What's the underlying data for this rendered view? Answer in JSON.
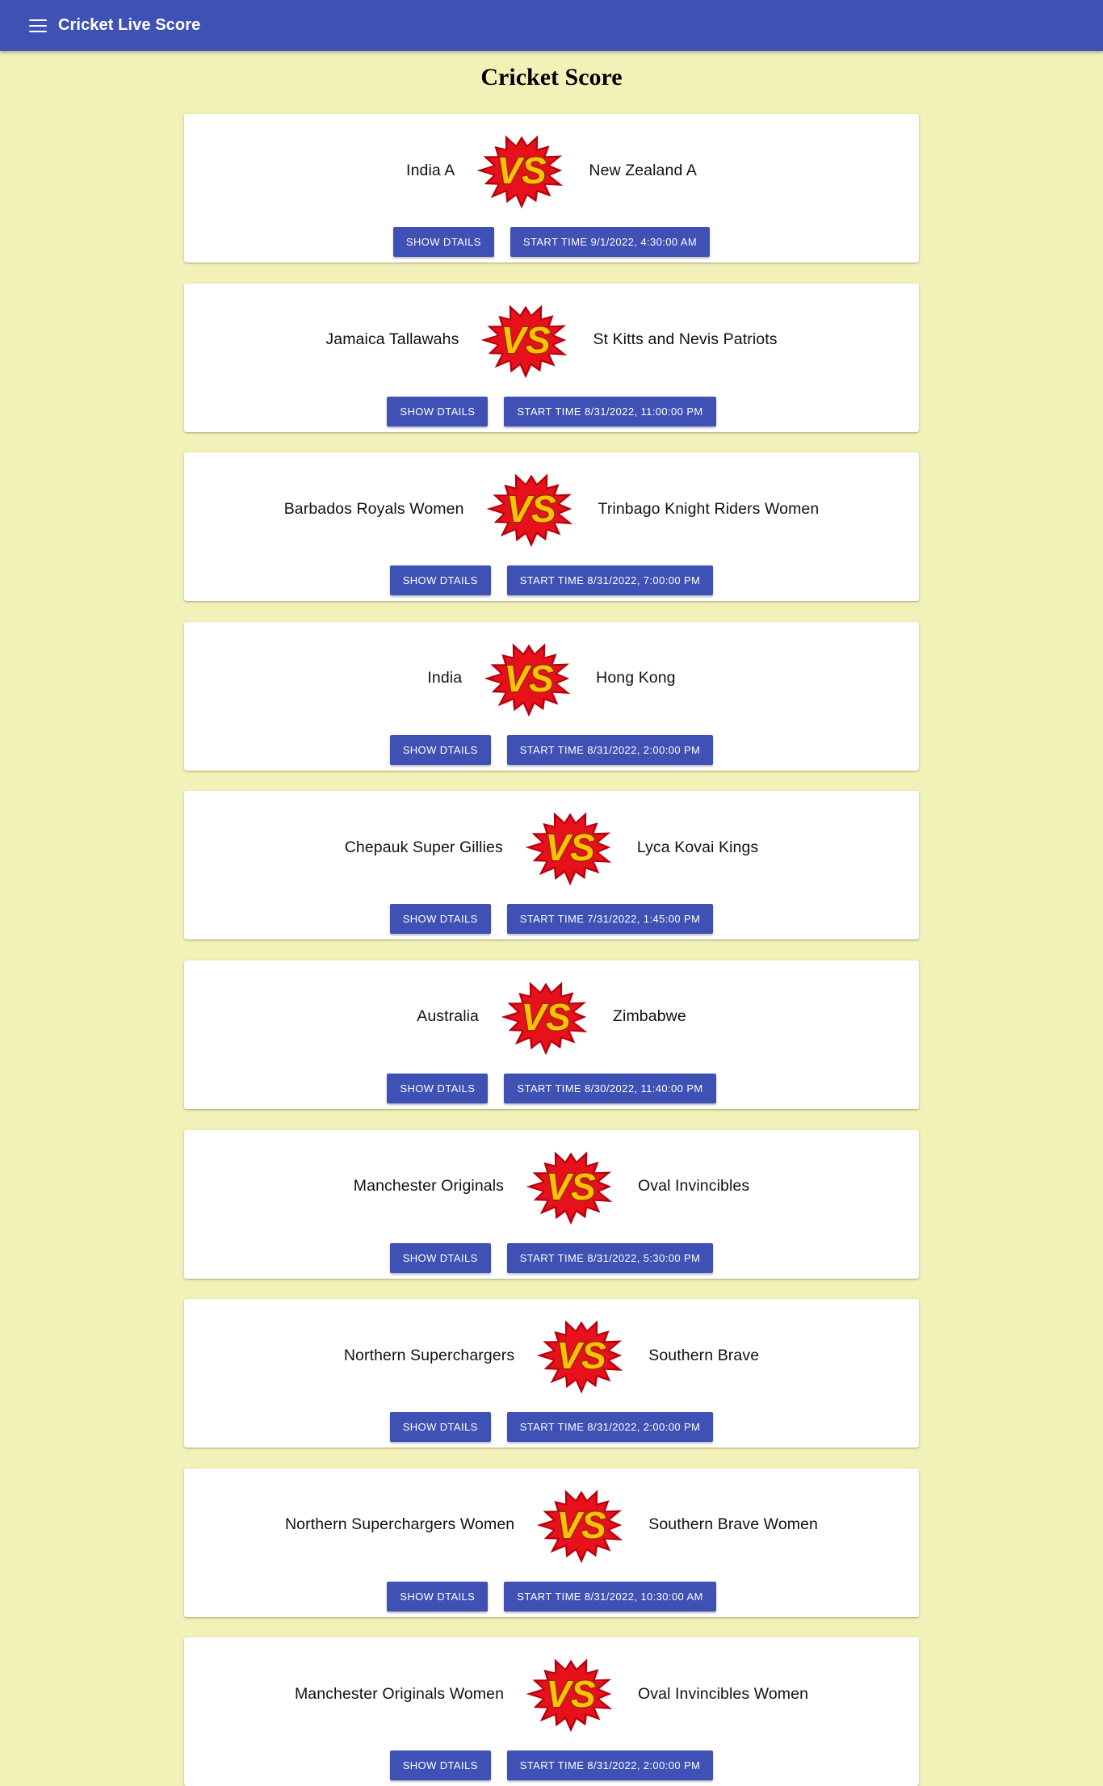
{
  "app": {
    "title": "Cricket Live Score",
    "menu_icon": "menu-icon"
  },
  "page": {
    "heading": "Cricket Score"
  },
  "colors": {
    "primary": "#3f51b5",
    "background": "#f2f1b7",
    "card": "#ffffff",
    "vs_fill": "#e8101a",
    "vs_letters": "#ffc107"
  },
  "vs_label": "VS",
  "matches": [
    {
      "team1": "India A",
      "team2": "New Zealand A",
      "details_label": "SHOW DTAILS",
      "start_label": "START TIME 9/1/2022, 4:30:00 AM"
    },
    {
      "team1": "Jamaica Tallawahs",
      "team2": "St Kitts and Nevis Patriots",
      "details_label": "SHOW DTAILS",
      "start_label": "START TIME 8/31/2022, 11:00:00 PM"
    },
    {
      "team1": "Barbados Royals Women",
      "team2": "Trinbago Knight Riders Women",
      "details_label": "SHOW DTAILS",
      "start_label": "START TIME 8/31/2022, 7:00:00 PM"
    },
    {
      "team1": "India",
      "team2": "Hong Kong",
      "details_label": "SHOW DTAILS",
      "start_label": "START TIME 8/31/2022, 2:00:00 PM"
    },
    {
      "team1": "Chepauk Super Gillies",
      "team2": "Lyca Kovai Kings",
      "details_label": "SHOW DTAILS",
      "start_label": "START TIME 7/31/2022, 1:45:00 PM"
    },
    {
      "team1": "Australia",
      "team2": "Zimbabwe",
      "details_label": "SHOW DTAILS",
      "start_label": "START TIME 8/30/2022, 11:40:00 PM"
    },
    {
      "team1": "Manchester Originals",
      "team2": "Oval Invincibles",
      "details_label": "SHOW DTAILS",
      "start_label": "START TIME 8/31/2022, 5:30:00 PM"
    },
    {
      "team1": "Northern Superchargers",
      "team2": "Southern Brave",
      "details_label": "SHOW DTAILS",
      "start_label": "START TIME 8/31/2022, 2:00:00 PM"
    },
    {
      "team1": "Northern Superchargers Women",
      "team2": "Southern Brave Women",
      "details_label": "SHOW DTAILS",
      "start_label": "START TIME 8/31/2022, 10:30:00 AM"
    },
    {
      "team1": "Manchester Originals Women",
      "team2": "Oval Invincibles Women",
      "details_label": "SHOW DTAILS",
      "start_label": "START TIME 8/31/2022, 2:00:00 PM"
    }
  ]
}
